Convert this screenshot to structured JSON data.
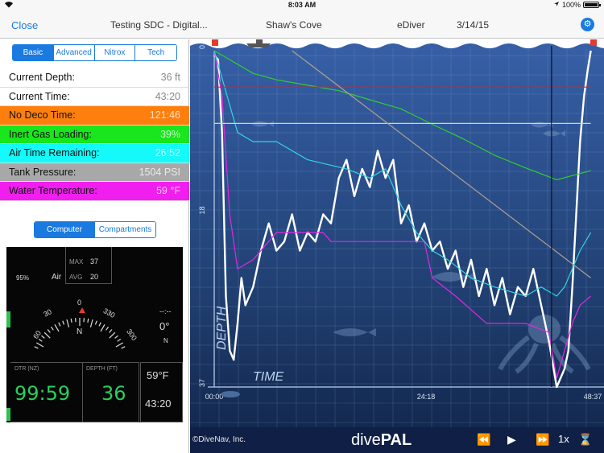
{
  "status": {
    "time": "8:03 AM",
    "battery": "100%"
  },
  "nav": {
    "close_label": "Close",
    "dive_name": "Testing SDC - Digital...",
    "site": "Shaw's Cove",
    "source": "eDiver",
    "date": "3/14/15"
  },
  "tabs": [
    {
      "label": "Basic",
      "active": true
    },
    {
      "label": "Advanced",
      "active": false
    },
    {
      "label": "Nitrox",
      "active": false
    },
    {
      "label": "Tech",
      "active": false
    }
  ],
  "readings": [
    {
      "label": "Current Depth:",
      "value": "36 ft",
      "color": ""
    },
    {
      "label": "Current Time:",
      "value": "43:20",
      "color": ""
    },
    {
      "label": "No Deco Time:",
      "value": "121:46",
      "color": "orange"
    },
    {
      "label": "Inert Gas Loading:",
      "value": "39%",
      "color": "green"
    },
    {
      "label": "Air Time Remaining:",
      "value": "26:52",
      "color": "cyan"
    },
    {
      "label": "Tank Pressure:",
      "value": "1504 PSI",
      "color": "gray"
    },
    {
      "label": "Water Temperature:",
      "value": "59 °F",
      "color": "magenta"
    }
  ],
  "view_tabs": [
    {
      "label": "Computer",
      "active": true
    },
    {
      "label": "Compartments",
      "active": false
    }
  ],
  "computer": {
    "max_label": "MAX",
    "max_value": "37",
    "avg_label": "AVG",
    "avg_value": "20",
    "o2_percent": "95%",
    "gas": "Air",
    "compass_ticks": [
      "60",
      "30",
      "0",
      "330",
      "300"
    ],
    "compass_heading_letter": "N",
    "bearing": "--:--",
    "heading": "0°",
    "heading_dir": "N",
    "dtr_label": "DTR (NZ)",
    "dtr_value": "99:59",
    "depth_label": "DEPTH (FT)",
    "depth_value": "36",
    "temp": "59°F",
    "time": "43:20"
  },
  "chart_data": {
    "type": "line",
    "x_ticks": [
      "00:00",
      "24:18",
      "48:37"
    ],
    "y_ticks": [
      "0",
      "18",
      "37"
    ],
    "axis_labels": {
      "y": "DEPTH",
      "x": "TIME"
    },
    "cursor_time": "43:20",
    "series": [
      {
        "name": "",
        "color": "#ffffff",
        "points": [
          [
            0,
            0.5
          ],
          [
            0.5,
            1
          ],
          [
            1,
            9
          ],
          [
            1.5,
            27
          ],
          [
            2,
            33
          ],
          [
            2.5,
            34
          ],
          [
            3,
            30
          ],
          [
            3.5,
            25
          ],
          [
            4,
            28
          ],
          [
            5,
            26
          ],
          [
            6,
            22
          ],
          [
            7,
            19
          ],
          [
            8,
            22
          ],
          [
            9,
            21
          ],
          [
            10,
            18
          ],
          [
            11,
            22
          ],
          [
            12,
            20
          ],
          [
            13,
            21
          ],
          [
            14,
            18
          ],
          [
            15,
            19
          ],
          [
            16,
            14
          ],
          [
            17,
            12
          ],
          [
            18,
            16
          ],
          [
            19,
            13
          ],
          [
            20,
            15
          ],
          [
            21,
            11
          ],
          [
            22,
            14
          ],
          [
            23,
            12
          ],
          [
            24,
            19
          ],
          [
            25,
            17
          ],
          [
            26,
            21
          ],
          [
            27,
            19
          ],
          [
            28,
            22
          ],
          [
            29,
            21
          ],
          [
            30,
            24
          ],
          [
            31,
            22
          ],
          [
            32,
            26
          ],
          [
            33,
            23
          ],
          [
            34,
            27
          ],
          [
            35,
            24
          ],
          [
            36,
            28
          ],
          [
            37,
            25
          ],
          [
            38,
            29
          ],
          [
            39,
            26
          ],
          [
            40,
            27
          ],
          [
            41,
            24
          ],
          [
            42,
            28
          ],
          [
            43,
            32
          ],
          [
            44,
            37
          ],
          [
            45,
            35
          ],
          [
            45.5,
            33
          ],
          [
            46,
            26
          ],
          [
            46.5,
            18
          ],
          [
            47,
            10
          ],
          [
            47.5,
            5
          ],
          [
            48,
            2
          ],
          [
            48.37,
            0
          ]
        ]
      },
      {
        "name": "",
        "color": "#e029e0",
        "points": [
          [
            0,
            0
          ],
          [
            1,
            5
          ],
          [
            2,
            18
          ],
          [
            3,
            24
          ],
          [
            5,
            23
          ],
          [
            8,
            20
          ],
          [
            14,
            20
          ],
          [
            15,
            21
          ],
          [
            27,
            21
          ],
          [
            28,
            25
          ],
          [
            31,
            27
          ],
          [
            35,
            30
          ],
          [
            40,
            30
          ],
          [
            43,
            31
          ],
          [
            44,
            36
          ],
          [
            45,
            33
          ],
          [
            46,
            30
          ],
          [
            47,
            28
          ],
          [
            48.37,
            27
          ]
        ]
      },
      {
        "name": "",
        "color": "#2fd6e0",
        "points": [
          [
            0,
            0
          ],
          [
            1,
            3
          ],
          [
            2,
            6
          ],
          [
            3,
            9
          ],
          [
            5,
            10
          ],
          [
            8,
            10
          ],
          [
            12,
            12
          ],
          [
            17,
            13
          ],
          [
            20,
            14
          ],
          [
            22,
            13
          ],
          [
            24,
            17
          ],
          [
            26,
            20
          ],
          [
            28,
            22
          ],
          [
            30,
            23
          ],
          [
            33,
            25
          ],
          [
            36,
            26
          ],
          [
            40,
            27
          ],
          [
            42,
            26
          ],
          [
            44,
            27
          ],
          [
            45,
            26
          ],
          [
            46,
            24
          ],
          [
            47,
            22
          ],
          [
            48.37,
            20
          ]
        ]
      },
      {
        "name": "",
        "color": "#2ed02e",
        "points": [
          [
            0,
            0
          ],
          [
            1,
            0.5
          ],
          [
            3,
            1.5
          ],
          [
            5,
            2.5
          ],
          [
            8,
            3.2
          ],
          [
            12,
            3.8
          ],
          [
            16,
            4.4
          ],
          [
            20,
            5.4
          ],
          [
            24,
            6.4
          ],
          [
            28,
            8.1
          ],
          [
            32,
            9.7
          ],
          [
            36,
            11.5
          ],
          [
            40,
            12.9
          ],
          [
            44,
            14.2
          ],
          [
            48.37,
            13.2
          ]
        ]
      },
      {
        "name": "",
        "color": "#e8e040",
        "points": [
          [
            0,
            8
          ],
          [
            48.37,
            8
          ]
        ]
      },
      {
        "name": "",
        "color": "#c82828",
        "points": [
          [
            0,
            4
          ],
          [
            48.37,
            4
          ]
        ]
      },
      {
        "name": "",
        "color": "#b0a090",
        "points": [
          [
            10,
            0
          ],
          [
            48.37,
            25
          ]
        ]
      }
    ]
  },
  "footer": {
    "copyright": "©DiveNav, Inc.",
    "logo_prefix": "dive",
    "logo_suffix": "PAL",
    "speed": "1x"
  }
}
